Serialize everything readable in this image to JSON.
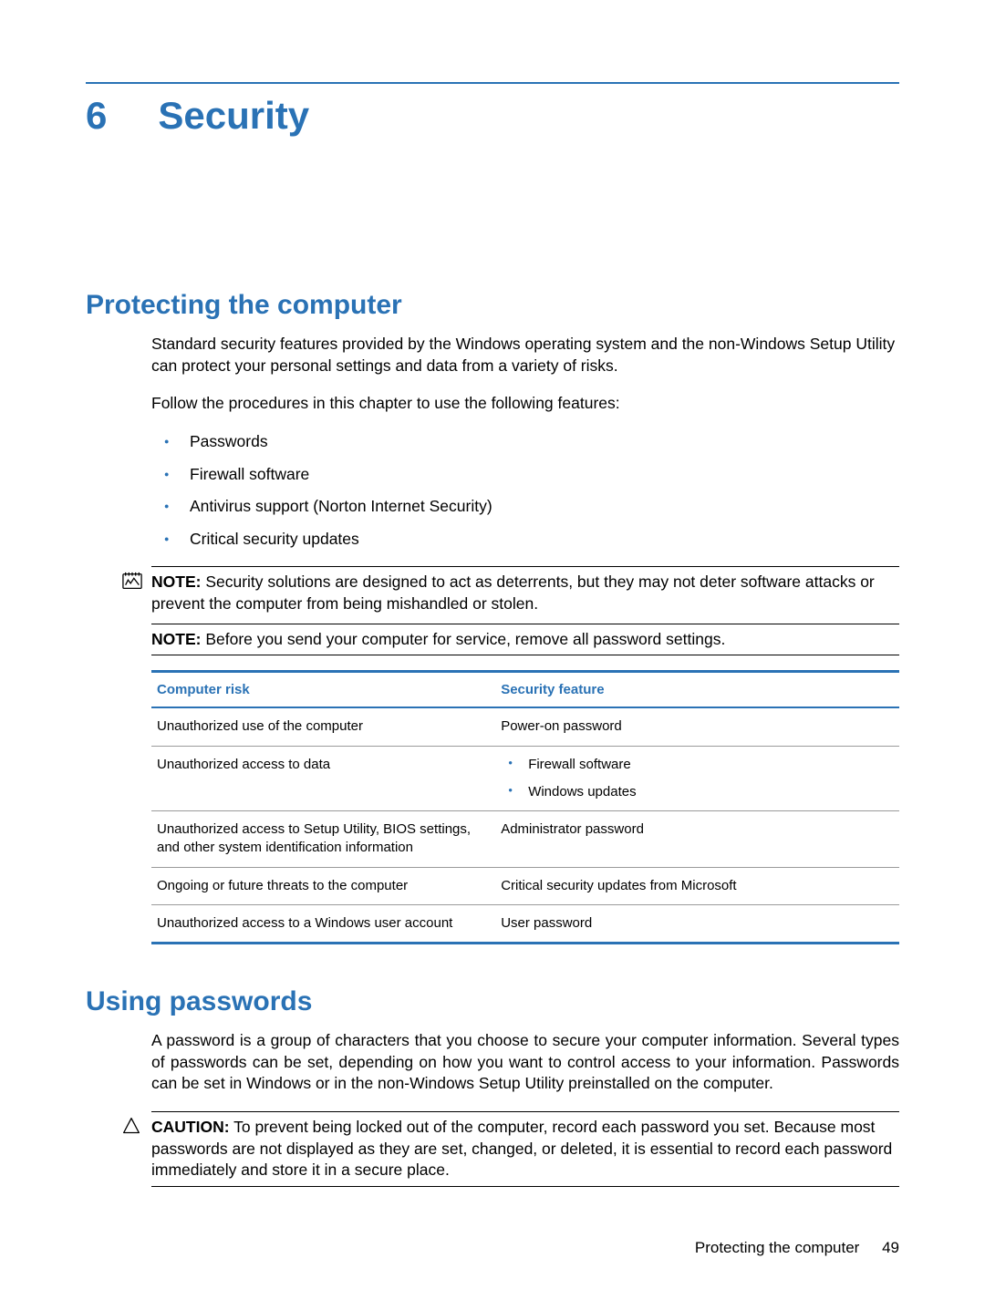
{
  "chapter": {
    "number": "6",
    "title": "Security"
  },
  "section1": {
    "heading": "Protecting the computer",
    "p1": "Standard security features provided by the Windows operating system and the non-Windows Setup Utility can protect your personal settings and data from a variety of risks.",
    "p2": "Follow the procedures in this chapter to use the following features:",
    "features": [
      "Passwords",
      "Firewall software",
      "Antivirus support (Norton Internet Security)",
      "Critical security updates"
    ],
    "note1_label": "NOTE:",
    "note1_text": "Security solutions are designed to act as deterrents, but they may not deter software attacks or prevent the computer from being mishandled or stolen.",
    "note2_label": "NOTE:",
    "note2_text": "Before you send your computer for service, remove all password settings."
  },
  "table": {
    "header_risk": "Computer risk",
    "header_feature": "Security feature",
    "rows": [
      {
        "risk": "Unauthorized use of the computer",
        "feature_text": "Power-on password"
      },
      {
        "risk": "Unauthorized access to data",
        "feature_list": [
          "Firewall software",
          "Windows updates"
        ]
      },
      {
        "risk": "Unauthorized access to Setup Utility, BIOS settings, and other system identification information",
        "feature_text": "Administrator password"
      },
      {
        "risk": "Ongoing or future threats to the computer",
        "feature_text": "Critical security updates from Microsoft"
      },
      {
        "risk": "Unauthorized access to a Windows user account",
        "feature_text": "User password"
      }
    ]
  },
  "section2": {
    "heading": "Using passwords",
    "p1": "A password is a group of characters that you choose to secure your computer information. Several types of passwords can be set, depending on how you want to control access to your information. Passwords can be set in Windows or in the non-Windows Setup Utility preinstalled on the computer.",
    "caution_label": "CAUTION:",
    "caution_text": "To prevent being locked out of the computer, record each password you set. Because most passwords are not displayed as they are set, changed, or deleted, it is essential to record each password immediately and store it in a secure place."
  },
  "footer": {
    "text": "Protecting the computer",
    "page": "49"
  }
}
